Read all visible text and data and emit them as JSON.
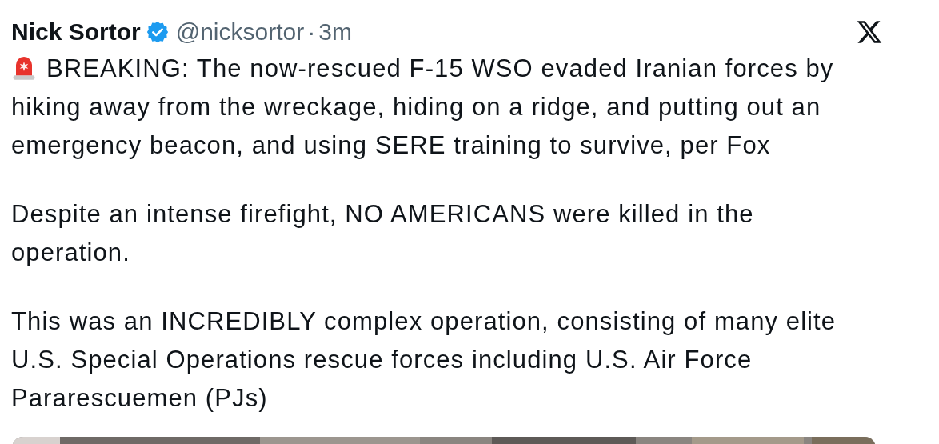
{
  "post": {
    "author_name": "Nick Sortor",
    "verified": true,
    "handle": "@nicksortor",
    "separator": "·",
    "time": "3m",
    "paragraphs": [
      {
        "text": "BREAKING: The now-rescued F-15 WSO evaded Iranian forces by hiking away from the wreckage, hiding on a ridge, and putting out an emergency beacon, and using SERE training to survive, per Fox",
        "siren": true
      },
      {
        "text": "Despite an intense firefight, NO AMERICANS were killed in the operation.",
        "siren": false
      },
      {
        "text": "This was an INCREDIBLY complex operation, consisting of many elite U.S. Special Operations rescue forces including U.S. Air Force Pararescuemen (PJs)",
        "siren": false
      }
    ]
  }
}
